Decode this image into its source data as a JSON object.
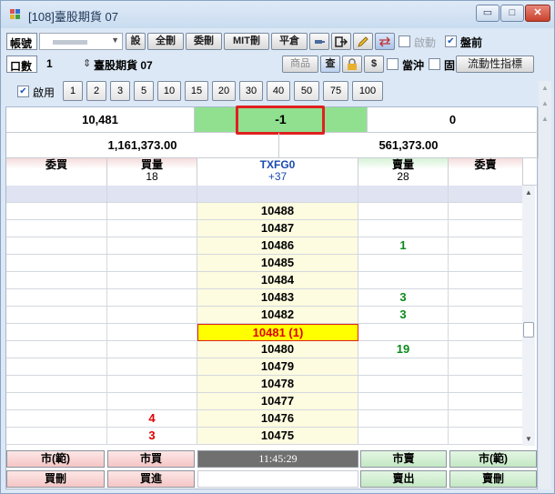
{
  "window": {
    "title": "[108]臺股期貨 07",
    "controls": {
      "minimize": "▭",
      "maximize": "□",
      "close": "✕"
    }
  },
  "toolbar1": {
    "account_label": "帳號",
    "account_value": "",
    "buttons": [
      "設",
      "全刪",
      "委刪",
      "MIT刪",
      "平倉"
    ],
    "activate_label": "啟動",
    "activate_checked": false,
    "close_label": "盤前",
    "close_checked": true
  },
  "toolbar2": {
    "qty_label": "口數",
    "qty_value": "1",
    "product_name": "臺股期貨 07",
    "buttons": [
      "商品",
      "查"
    ],
    "dollar_label": "$",
    "daytrade_label": "當沖",
    "fixed_label": "固",
    "liquidity_label": "流動性指標"
  },
  "qtybar": {
    "enable_label": "啟用",
    "enable_checked": true,
    "quantities": [
      "1",
      "2",
      "3",
      "5",
      "10",
      "15",
      "20",
      "30",
      "40",
      "50",
      "75",
      "100"
    ]
  },
  "summary": {
    "left_value": "10,481",
    "mid_value": "-1",
    "right_value": "0",
    "left_amount": "1,161,373.00",
    "right_amount": "561,373.00"
  },
  "columns": {
    "buy_order": "委買",
    "buy_qty": "買量",
    "buy_qty_sub": "18",
    "symbol": "TXFG0",
    "symbol_change": "+37",
    "sell_qty": "賣量",
    "sell_qty_sub": "28",
    "sell_order": "委賣"
  },
  "ladder": [
    {
      "buy": "",
      "price": "",
      "sell": ""
    },
    {
      "buy": "",
      "price": "10488",
      "sell": ""
    },
    {
      "buy": "",
      "price": "10487",
      "sell": ""
    },
    {
      "buy": "",
      "price": "10486",
      "sell": "1"
    },
    {
      "buy": "",
      "price": "10485",
      "sell": ""
    },
    {
      "buy": "",
      "price": "10484",
      "sell": ""
    },
    {
      "buy": "",
      "price": "10483",
      "sell": "3"
    },
    {
      "buy": "",
      "price": "10482",
      "sell": "3"
    },
    {
      "buy": "",
      "price": "10481 (1)",
      "sell": ""
    },
    {
      "buy": "",
      "price": "10480",
      "sell": "19"
    },
    {
      "buy": "",
      "price": "10479",
      "sell": ""
    },
    {
      "buy": "",
      "price": "10478",
      "sell": ""
    },
    {
      "buy": "",
      "price": "10477",
      "sell": ""
    },
    {
      "buy": "4",
      "price": "10476",
      "sell": ""
    },
    {
      "buy": "3",
      "price": "10475",
      "sell": ""
    }
  ],
  "actions_row1": {
    "market_buy_range": "市(範)",
    "market_buy": "市買",
    "time": "11:45:29",
    "market_sell": "市賣",
    "market_sell_range": "市(範)"
  },
  "actions_row2": {
    "buy_delete": "買刪",
    "buy_in": "買進",
    "sell_out": "賣出",
    "sell_delete": "賣刪"
  },
  "colors": {
    "highlight_box": "#e02020",
    "mid_cell_bg": "#90e090",
    "current_price_bg": "#ffff00",
    "sell_qty_color": "#0a8a1a",
    "buy_qty_color": "#e00000"
  }
}
